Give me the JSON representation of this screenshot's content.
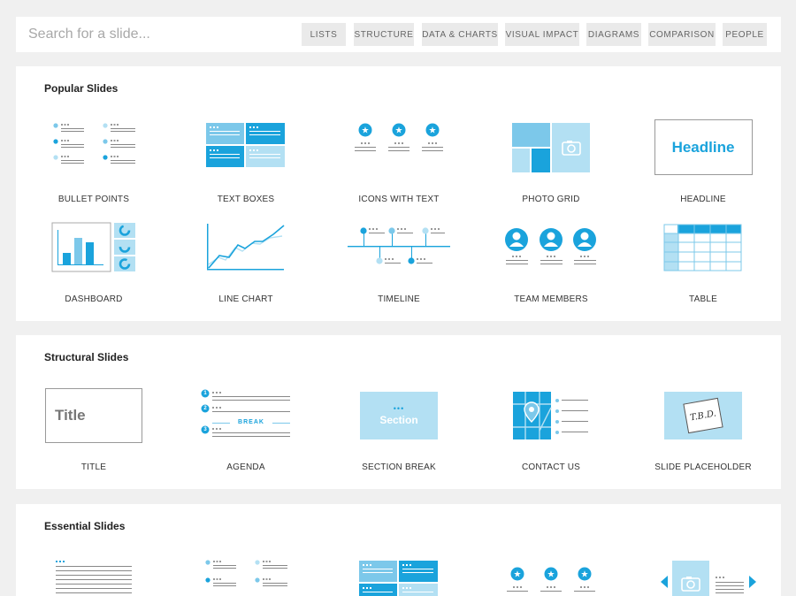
{
  "search": {
    "placeholder": "Search for a slide..."
  },
  "categories": [
    "LISTS",
    "STRUCTURE",
    "DATA & CHARTS",
    "VISUAL IMPACT",
    "DIAGRAMS",
    "COMPARISON",
    "PEOPLE"
  ],
  "popular": {
    "title": "Popular Slides",
    "items": [
      {
        "label": "BULLET POINTS",
        "icon": "bullet-points-thumbnail"
      },
      {
        "label": "TEXT BOXES",
        "icon": "text-boxes-thumbnail"
      },
      {
        "label": "ICONS WITH TEXT",
        "icon": "icons-with-text-thumbnail"
      },
      {
        "label": "PHOTO GRID",
        "icon": "photo-grid-thumbnail"
      },
      {
        "label": "HEADLINE",
        "icon": "headline-thumbnail",
        "preview_text": "Headline"
      },
      {
        "label": "DASHBOARD",
        "icon": "dashboard-thumbnail"
      },
      {
        "label": "LINE CHART",
        "icon": "line-chart-thumbnail"
      },
      {
        "label": "TIMELINE",
        "icon": "timeline-thumbnail"
      },
      {
        "label": "TEAM MEMBERS",
        "icon": "team-members-thumbnail"
      },
      {
        "label": "TABLE",
        "icon": "table-thumbnail"
      }
    ]
  },
  "structural": {
    "title": "Structural Slides",
    "items": [
      {
        "label": "TITLE",
        "icon": "title-thumbnail",
        "preview_text": "Title"
      },
      {
        "label": "AGENDA",
        "icon": "agenda-thumbnail",
        "preview_text": "BREAK",
        "numbers": [
          "1",
          "2",
          "3"
        ]
      },
      {
        "label": "SECTION BREAK",
        "icon": "section-break-thumbnail",
        "preview_text": "Section"
      },
      {
        "label": "CONTACT US",
        "icon": "contact-us-thumbnail"
      },
      {
        "label": "SLIDE PLACEHOLDER",
        "icon": "slide-placeholder-thumbnail",
        "preview_text": "T.B.D."
      }
    ]
  },
  "essential": {
    "title": "Essential Slides",
    "items": [
      {
        "icon": "text-list-thumbnail"
      },
      {
        "icon": "bullet-points-thumbnail"
      },
      {
        "icon": "text-boxes-thumbnail"
      },
      {
        "icon": "icons-with-text-thumbnail"
      },
      {
        "icon": "image-carousel-thumbnail"
      }
    ]
  },
  "colors": {
    "accent": "#1aa3dc",
    "accent_light": "#b3e0f3",
    "accent_mid": "#7cc8ea",
    "gray_line": "#888888",
    "page_bg": "#f0f0f0"
  }
}
